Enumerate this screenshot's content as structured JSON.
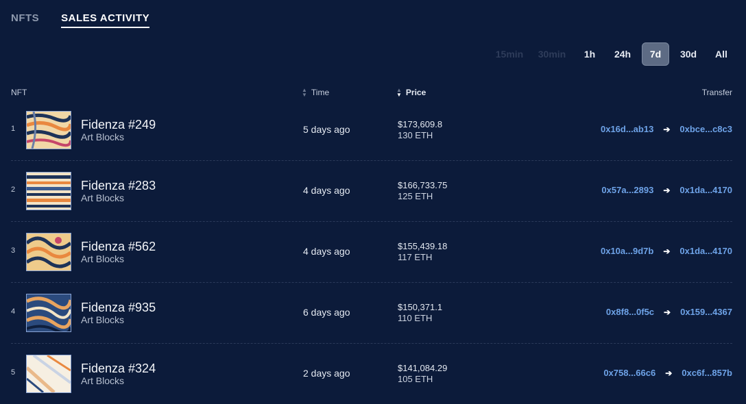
{
  "tabs": [
    {
      "label": "NFTS",
      "active": false
    },
    {
      "label": "SALES ACTIVITY",
      "active": true
    }
  ],
  "time_ranges": [
    {
      "label": "15min",
      "state": "disabled"
    },
    {
      "label": "30min",
      "state": "disabled"
    },
    {
      "label": "1h",
      "state": "normal"
    },
    {
      "label": "24h",
      "state": "normal"
    },
    {
      "label": "7d",
      "state": "selected"
    },
    {
      "label": "30d",
      "state": "normal"
    },
    {
      "label": "All",
      "state": "normal"
    }
  ],
  "table": {
    "headers": {
      "nft": "NFT",
      "time": "Time",
      "price": "Price",
      "transfer": "Transfer"
    },
    "rows": [
      {
        "rank": "1",
        "name": "Fidenza #249",
        "collection": "Art Blocks",
        "time": "5 days ago",
        "price_usd": "$173,609.8",
        "price_eth": "130 ETH",
        "from": "0x16d...ab13",
        "to": "0xbce...c8c3"
      },
      {
        "rank": "2",
        "name": "Fidenza #283",
        "collection": "Art Blocks",
        "time": "4 days ago",
        "price_usd": "$166,733.75",
        "price_eth": "125 ETH",
        "from": "0x57a...2893",
        "to": "0x1da...4170"
      },
      {
        "rank": "3",
        "name": "Fidenza #562",
        "collection": "Art Blocks",
        "time": "4 days ago",
        "price_usd": "$155,439.18",
        "price_eth": "117 ETH",
        "from": "0x10a...9d7b",
        "to": "0x1da...4170"
      },
      {
        "rank": "4",
        "name": "Fidenza #935",
        "collection": "Art Blocks",
        "time": "6 days ago",
        "price_usd": "$150,371.1",
        "price_eth": "110 ETH",
        "from": "0x8f8...0f5c",
        "to": "0x159...4367"
      },
      {
        "rank": "5",
        "name": "Fidenza #324",
        "collection": "Art Blocks",
        "time": "2 days ago",
        "price_usd": "$141,084.29",
        "price_eth": "105 ETH",
        "from": "0x758...66c6",
        "to": "0xc6f...857b"
      }
    ]
  },
  "icons": {
    "sort": "sort-icon",
    "arrow": "arrow-right-icon",
    "thumbnail": "artwork-thumbnail"
  },
  "colors": {
    "background": "#0c1b3a",
    "address": "#6ea3e8",
    "selected_range": "#5d6b84"
  }
}
